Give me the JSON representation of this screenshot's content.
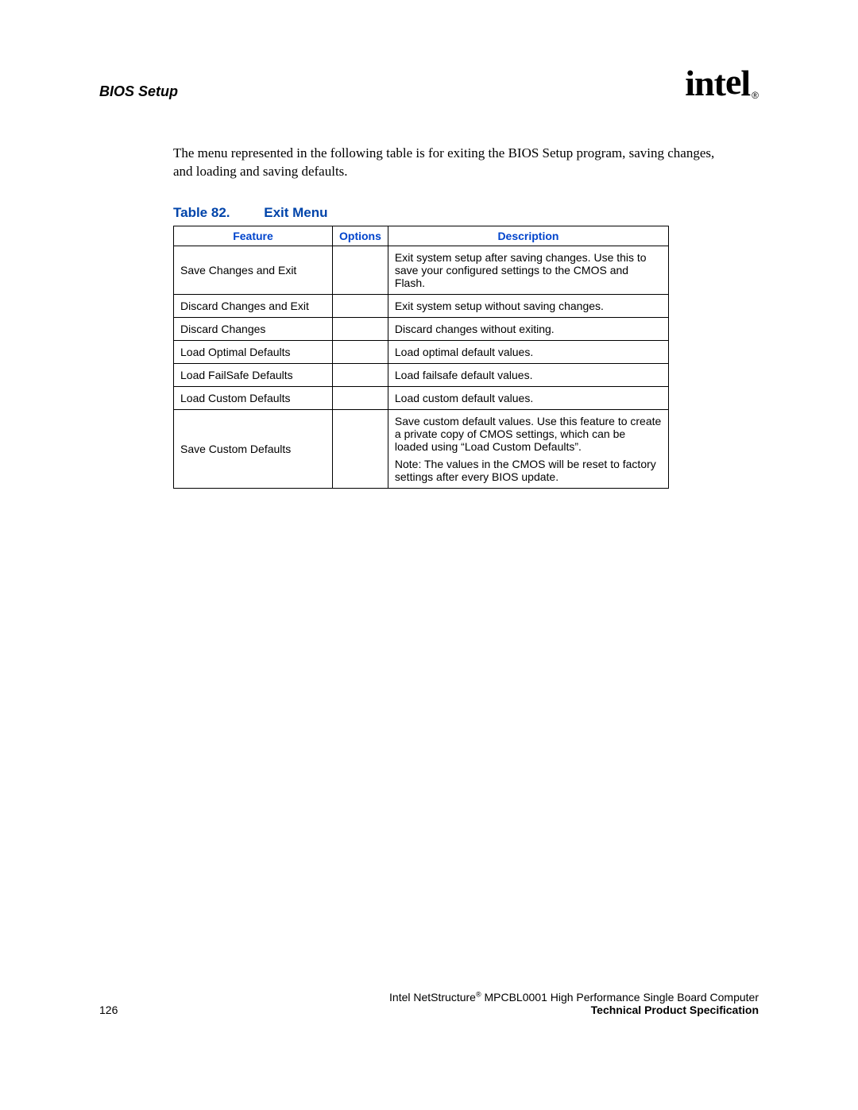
{
  "header": {
    "title": "BIOS Setup",
    "logo_text_1": "int",
    "logo_text_2": "e",
    "logo_text_3": "l",
    "logo_reg": "®"
  },
  "intro_text": "The menu represented in the following table is for exiting the BIOS Setup program, saving changes, and loading and saving defaults.",
  "table": {
    "caption_num": "Table 82.",
    "caption_name": "Exit Menu",
    "headers": {
      "feature": "Feature",
      "options": "Options",
      "description": "Description"
    },
    "rows": [
      {
        "feature": "Save Changes and Exit",
        "options": "",
        "description": [
          "Exit system setup after saving changes. Use this to save your configured settings to the CMOS and Flash."
        ]
      },
      {
        "feature": "Discard Changes and Exit",
        "options": "",
        "description": [
          "Exit system setup without saving changes."
        ]
      },
      {
        "feature": "Discard Changes",
        "options": "",
        "description": [
          "Discard changes without exiting."
        ]
      },
      {
        "feature": "Load Optimal Defaults",
        "options": "",
        "description": [
          "Load optimal default values."
        ]
      },
      {
        "feature": "Load FailSafe Defaults",
        "options": "",
        "description": [
          "Load failsafe default values."
        ]
      },
      {
        "feature": "Load Custom Defaults",
        "options": "",
        "description": [
          "Load custom default values."
        ]
      },
      {
        "feature": "Save Custom Defaults",
        "options": "",
        "description": [
          "Save custom default values. Use this feature to create a private copy of CMOS settings, which can be loaded using “Load Custom Defaults”.",
          "Note: The values in the CMOS will be reset to factory settings after every BIOS update."
        ]
      }
    ]
  },
  "footer": {
    "page_number": "126",
    "right_line1_a": "Intel NetStructure",
    "right_line1_sup": "®",
    "right_line1_b": " MPCBL0001 High Performance Single Board Computer",
    "right_line2": "Technical Product Specification"
  }
}
